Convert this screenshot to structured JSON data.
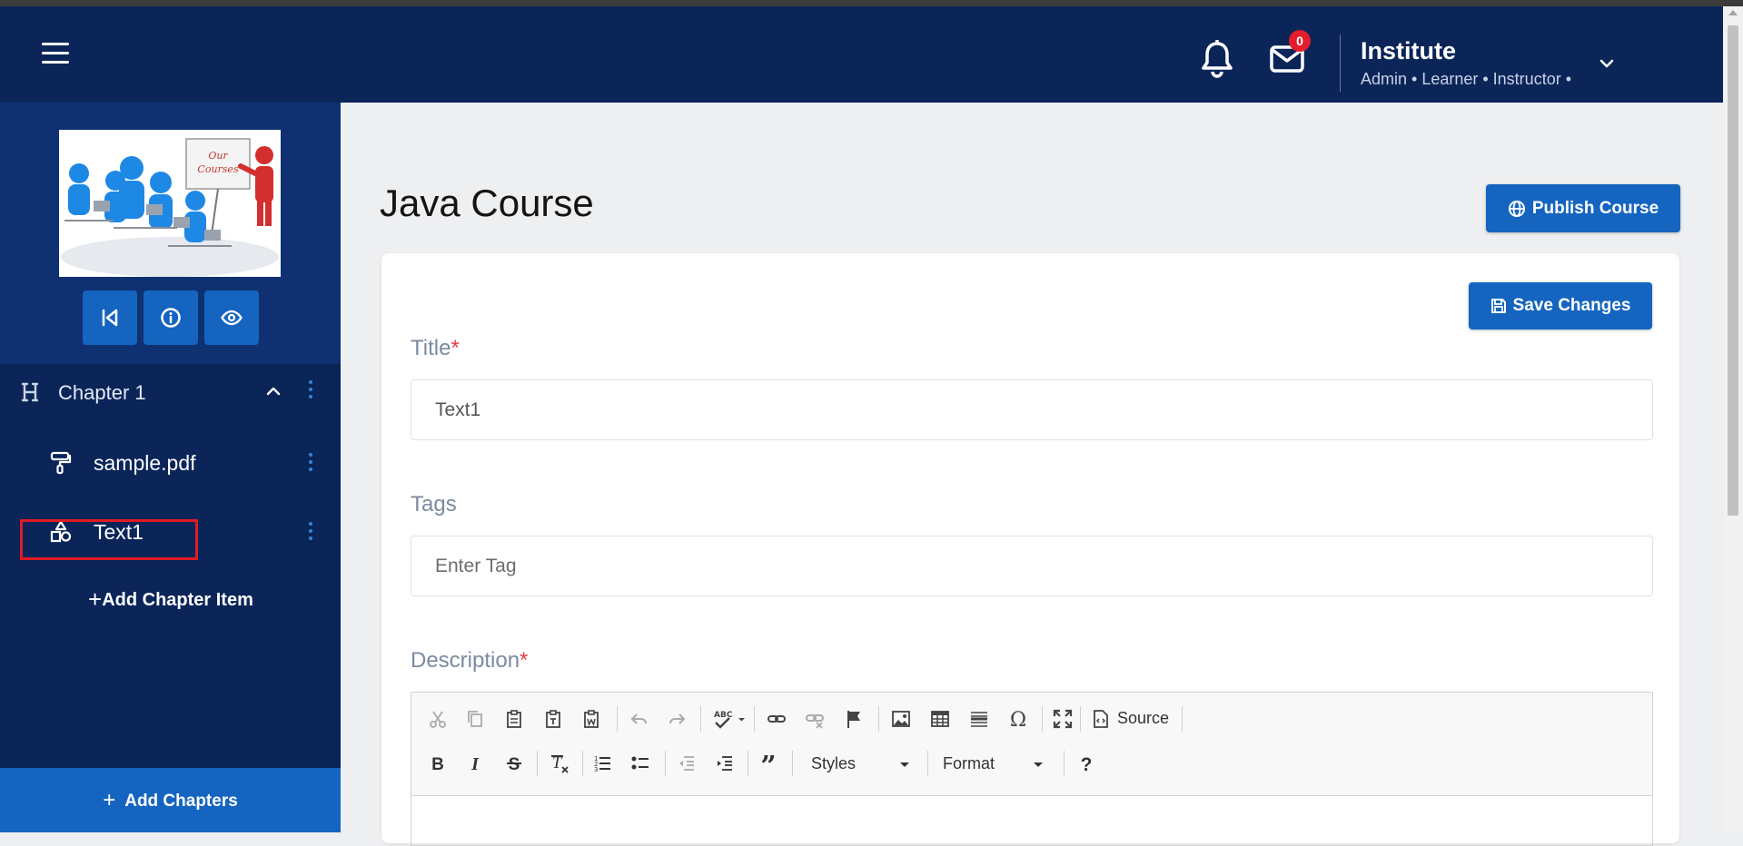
{
  "header": {
    "menu_icon": "hamburger-icon",
    "notification_icon": "bell-icon",
    "mail_icon": "mail-icon",
    "mail_badge": "0",
    "user": {
      "name": "Institute",
      "roles": "Admin • Learner • Instructor •"
    },
    "dropdown_icon": "chevron-down-icon"
  },
  "sidebar": {
    "course_image_caption": "Our Courses",
    "buttons": [
      {
        "icon": "skip-back-icon"
      },
      {
        "icon": "info-icon"
      },
      {
        "icon": "eye-icon"
      }
    ],
    "chapter": {
      "label": "Chapter 1",
      "items": [
        {
          "label": "sample.pdf",
          "icon": "paint-roller-icon"
        },
        {
          "label": "Text1",
          "icon": "shapes-icon"
        }
      ]
    },
    "add_item_label": "Add Chapter Item",
    "add_chapters_label": "Add Chapters"
  },
  "main": {
    "title": "Java Course",
    "publish_label": "Publish Course",
    "save_label": "Save Changes",
    "form": {
      "title_label": "Title",
      "title_value": "Text1",
      "tags_label": "Tags",
      "tags_placeholder": "Enter Tag",
      "description_label": "Description",
      "required_mark": "*"
    },
    "editor": {
      "source_label": "Source",
      "styles_label": "Styles",
      "format_label": "Format"
    }
  },
  "colors": {
    "nav_bg": "#0b2559",
    "sidebar_top_bg": "#0f3172",
    "primary": "#1565c0",
    "badge": "#e21d2c",
    "highlight": "#e01b22"
  }
}
